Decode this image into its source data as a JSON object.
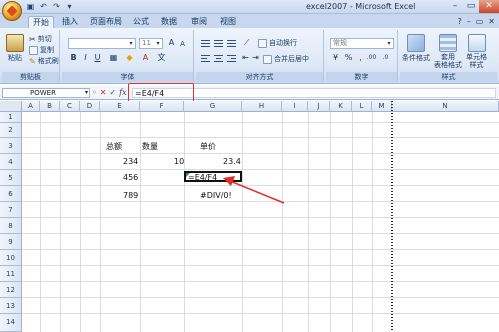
{
  "window": {
    "title": "excel2007 - Microsoft Excel",
    "qat_icons": [
      "save-icon",
      "undo-icon",
      "redo-icon",
      "customize-icon"
    ],
    "controls": [
      "–",
      "▭",
      "✕"
    ]
  },
  "tabs": [
    "开始",
    "插入",
    "页面布局",
    "公式",
    "数据",
    "审阅",
    "视图"
  ],
  "tabs_right": [
    "?",
    "–",
    "▭",
    "✕"
  ],
  "ribbon": {
    "clipboard": {
      "label": "剪贴板",
      "paste": "粘贴",
      "cut": "剪切",
      "copy": "复制",
      "format_painter": "格式刷"
    },
    "font": {
      "label": "字体",
      "font_name": "",
      "font_size": "11",
      "grow": "A",
      "shrink": "A",
      "bold": "B",
      "italic": "I",
      "underline": "U"
    },
    "alignment": {
      "label": "对齐方式",
      "wrap": "自动换行",
      "merge": "合并后居中"
    },
    "number": {
      "label": "数字",
      "format": "常规",
      "currency": "%",
      "percent": "%",
      "comma": ",",
      "inc": ".00",
      "dec": ".0"
    },
    "styles": {
      "label": "样式",
      "conditional": "条件格式",
      "table": "套用\n表格格式",
      "cell": "单元格\n样式"
    }
  },
  "formula_bar": {
    "name_box": "POWER",
    "formula": "=E4/F4",
    "fx": "fx"
  },
  "grid": {
    "columns": [
      "A",
      "B",
      "C",
      "D",
      "E",
      "F",
      "G",
      "H",
      "I",
      "J",
      "K",
      "L",
      "M",
      "N"
    ],
    "rows": [
      "1",
      "2",
      "3",
      "4",
      "5",
      "6",
      "7",
      "8",
      "9",
      "10",
      "11",
      "12",
      "13",
      "14"
    ],
    "cells": {
      "E2": "总额",
      "F2": "数量",
      "G2": "单价",
      "E3": "234",
      "F3": "10",
      "G3": "23.4",
      "E4": "456",
      "G4": "=E4/F4",
      "E5": "789",
      "G5": "#DIV/0!"
    }
  },
  "colors": {
    "highlight": "#e0302a",
    "ribbon_bg": "#dde8f6",
    "active_tab_bg": "#eef4fc"
  }
}
